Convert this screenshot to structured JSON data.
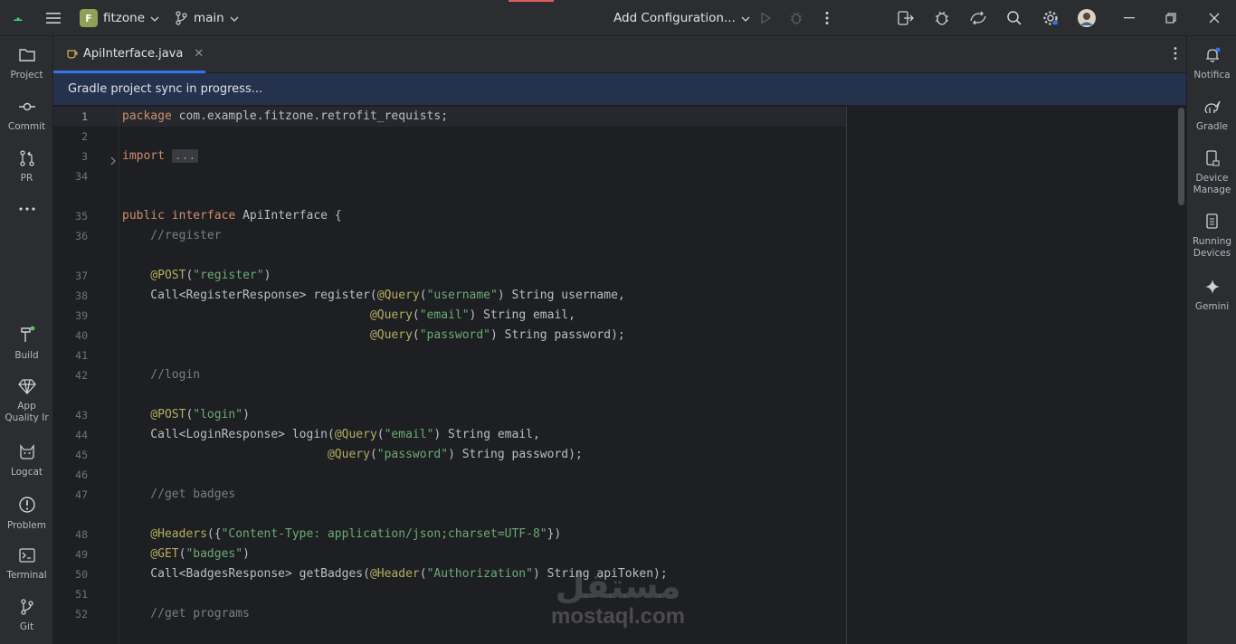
{
  "titlebar": {
    "project_initial": "F",
    "project_name": "fitzone",
    "branch": "main",
    "run_config": "Add Configuration..."
  },
  "tabs": [
    {
      "label": "ApiInterface.java",
      "active": true
    }
  ],
  "banner": {
    "text": "Gradle project sync in progress..."
  },
  "left_strip": [
    {
      "label": "Project",
      "icon": "folder-icon"
    },
    {
      "label": "Commit",
      "icon": "commit-icon"
    },
    {
      "label": "PR",
      "icon": "pull-request-icon"
    },
    {
      "label": "Build",
      "icon": "hammer-icon"
    },
    {
      "label": "App Quality Ir",
      "icon": "diamond-icon"
    },
    {
      "label": "Logcat",
      "icon": "cat-icon"
    },
    {
      "label": "Problem",
      "icon": "warning-icon"
    },
    {
      "label": "Terminal",
      "icon": "terminal-icon"
    },
    {
      "label": "Git",
      "icon": "git-icon"
    }
  ],
  "right_strip": [
    {
      "label": "Notifica",
      "icon": "bell-icon"
    },
    {
      "label": "Gradle",
      "icon": "elephant-icon"
    },
    {
      "label": "Device Manage",
      "icon": "device-icon"
    },
    {
      "label": "Running Devices",
      "icon": "running-devices-icon"
    },
    {
      "label": "Gemini",
      "icon": "sparkle-icon"
    }
  ],
  "editor": {
    "current_line": 1,
    "lines": [
      {
        "n": "1",
        "segs": [
          [
            "kw",
            "package"
          ],
          [
            "",
            " com.example.fitzone.retrofit_requists;"
          ]
        ]
      },
      {
        "n": "2",
        "segs": []
      },
      {
        "n": "3",
        "segs": [
          [
            "kw",
            "import"
          ],
          [
            "",
            " "
          ],
          [
            "fold",
            "..."
          ]
        ]
      },
      {
        "n": "34",
        "segs": []
      },
      {
        "n": "",
        "segs": []
      },
      {
        "n": "35",
        "segs": [
          [
            "kw",
            "public"
          ],
          [
            "",
            " "
          ],
          [
            "kw",
            "interface"
          ],
          [
            "",
            " ApiInterface {"
          ]
        ]
      },
      {
        "n": "36",
        "segs": [
          [
            "cmt",
            "    //register"
          ]
        ]
      },
      {
        "n": "",
        "segs": []
      },
      {
        "n": "37",
        "segs": [
          [
            "ann",
            "    @POST"
          ],
          [
            "",
            "("
          ],
          [
            "str",
            "\"register\""
          ],
          [
            "",
            ")"
          ]
        ]
      },
      {
        "n": "38",
        "segs": [
          [
            "",
            "    Call<RegisterResponse> register("
          ],
          [
            "ann",
            "@Query"
          ],
          [
            "",
            "("
          ],
          [
            "str",
            "\"username\""
          ],
          [
            "",
            ") String username,"
          ]
        ]
      },
      {
        "n": "39",
        "segs": [
          [
            "",
            "                                   "
          ],
          [
            "ann",
            "@Query"
          ],
          [
            "",
            "("
          ],
          [
            "str",
            "\"email\""
          ],
          [
            "",
            ") String email,"
          ]
        ]
      },
      {
        "n": "40",
        "segs": [
          [
            "",
            "                                   "
          ],
          [
            "ann",
            "@Query"
          ],
          [
            "",
            "("
          ],
          [
            "str",
            "\"password\""
          ],
          [
            "",
            ") String password);"
          ]
        ]
      },
      {
        "n": "41",
        "segs": []
      },
      {
        "n": "42",
        "segs": [
          [
            "cmt",
            "    //login"
          ]
        ]
      },
      {
        "n": "",
        "segs": []
      },
      {
        "n": "43",
        "segs": [
          [
            "ann",
            "    @POST"
          ],
          [
            "",
            "("
          ],
          [
            "str",
            "\"login\""
          ],
          [
            "",
            ")"
          ]
        ]
      },
      {
        "n": "44",
        "segs": [
          [
            "",
            "    Call<LoginResponse> login("
          ],
          [
            "ann",
            "@Query"
          ],
          [
            "",
            "("
          ],
          [
            "str",
            "\"email\""
          ],
          [
            "",
            ") String email,"
          ]
        ]
      },
      {
        "n": "45",
        "segs": [
          [
            "",
            "                             "
          ],
          [
            "ann",
            "@Query"
          ],
          [
            "",
            "("
          ],
          [
            "str",
            "\"password\""
          ],
          [
            "",
            ") String password);"
          ]
        ]
      },
      {
        "n": "46",
        "segs": []
      },
      {
        "n": "47",
        "segs": [
          [
            "cmt",
            "    //get badges"
          ]
        ]
      },
      {
        "n": "",
        "segs": []
      },
      {
        "n": "48",
        "segs": [
          [
            "ann",
            "    @Headers"
          ],
          [
            "",
            "({"
          ],
          [
            "str",
            "\"Content-Type: application/json;charset=UTF-8\""
          ],
          [
            "",
            "})"
          ]
        ]
      },
      {
        "n": "49",
        "segs": [
          [
            "ann",
            "    @GET"
          ],
          [
            "",
            "("
          ],
          [
            "str",
            "\"badges\""
          ],
          [
            "",
            ")"
          ]
        ]
      },
      {
        "n": "50",
        "segs": [
          [
            "",
            "    Call<BadgesResponse> getBadges("
          ],
          [
            "ann",
            "@Header"
          ],
          [
            "",
            "("
          ],
          [
            "str",
            "\"Authorization\""
          ],
          [
            "",
            ") String apiToken);"
          ]
        ]
      },
      {
        "n": "51",
        "segs": []
      },
      {
        "n": "52",
        "segs": [
          [
            "cmt",
            "    //get programs"
          ]
        ]
      }
    ]
  },
  "watermark": {
    "arabic": "مستقل",
    "latin": "mostaql.com"
  }
}
